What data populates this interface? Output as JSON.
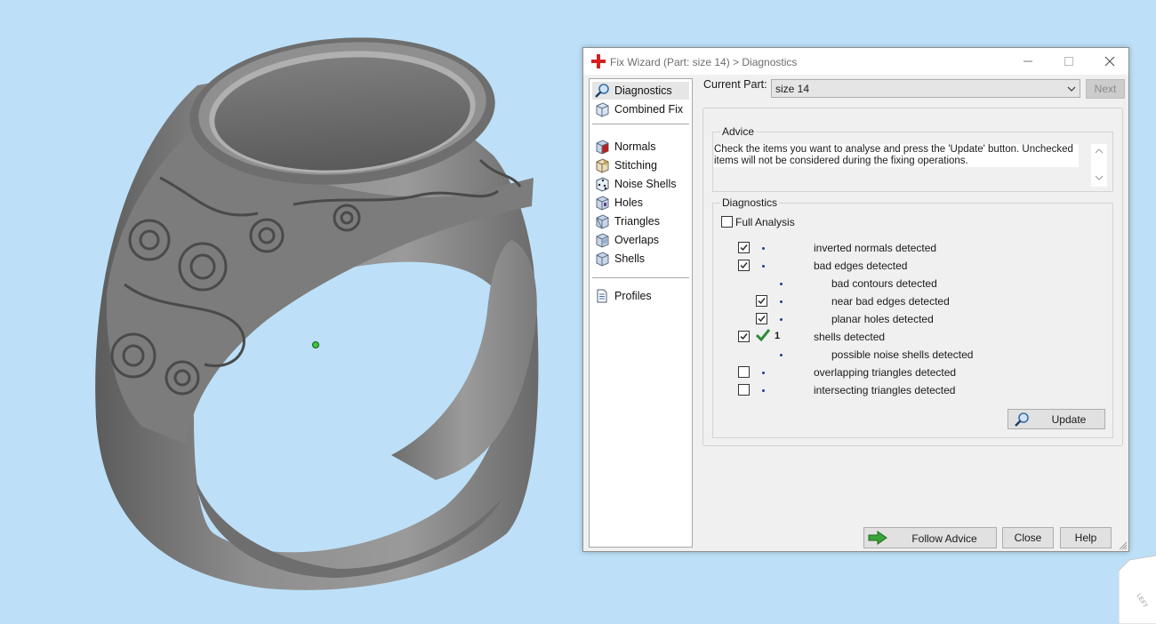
{
  "window": {
    "title": "Fix Wizard (Part: size 14) > Diagnostics"
  },
  "nav": {
    "items": [
      {
        "label": "Diagnostics",
        "icon": "magnifier-icon",
        "selected": true
      },
      {
        "label": "Combined Fix",
        "icon": "cube-icon"
      },
      {
        "label": "Normals",
        "icon": "normals-cube-icon"
      },
      {
        "label": "Stitching",
        "icon": "stitching-cube-icon"
      },
      {
        "label": "Noise Shells",
        "icon": "dice-icon"
      },
      {
        "label": "Holes",
        "icon": "holes-cube-icon"
      },
      {
        "label": "Triangles",
        "icon": "triangles-cube-icon"
      },
      {
        "label": "Overlaps",
        "icon": "overlaps-cube-icon"
      },
      {
        "label": "Shells",
        "icon": "shells-cube-icon"
      },
      {
        "label": "Profiles",
        "icon": "document-icon"
      }
    ]
  },
  "current_part": {
    "label": "Current Part:",
    "value": "size 14"
  },
  "next_label": "Next",
  "advice": {
    "title": "Advice",
    "text": "Check the items you want to analyse and press the 'Update' button. Unchecked items will not be considered during the fixing operations."
  },
  "diagnostics": {
    "title": "Diagnostics",
    "full_analysis": {
      "label": "Full Analysis",
      "checked": false
    },
    "rows": [
      {
        "label": "inverted normals detected",
        "checked": true,
        "count": "",
        "status": ""
      },
      {
        "label": "bad edges detected",
        "checked": true,
        "count": "",
        "status": ""
      },
      {
        "label": "bad contours detected",
        "checked": null,
        "count": "",
        "status": ""
      },
      {
        "label": "near bad edges detected",
        "checked": true,
        "count": "",
        "status": ""
      },
      {
        "label": "planar holes detected",
        "checked": true,
        "count": "",
        "status": ""
      },
      {
        "label": "shells detected",
        "checked": true,
        "count": "1",
        "status": "ok"
      },
      {
        "label": "possible noise shells detected",
        "checked": null,
        "count": "",
        "status": ""
      },
      {
        "label": "overlapping triangles detected",
        "checked": false,
        "count": "",
        "status": ""
      },
      {
        "label": "intersecting triangles detected",
        "checked": false,
        "count": "",
        "status": ""
      }
    ]
  },
  "buttons": {
    "update": "Update",
    "follow_advice": "Follow Advice",
    "close": "Close",
    "help": "Help"
  },
  "viewcube": {
    "face_label": "LEFT"
  },
  "colors": {
    "viewport_bg": "#bde0f8",
    "model": "#7a7a7a",
    "check_green": "#2e8b3a",
    "accent_red": "#d42020"
  }
}
